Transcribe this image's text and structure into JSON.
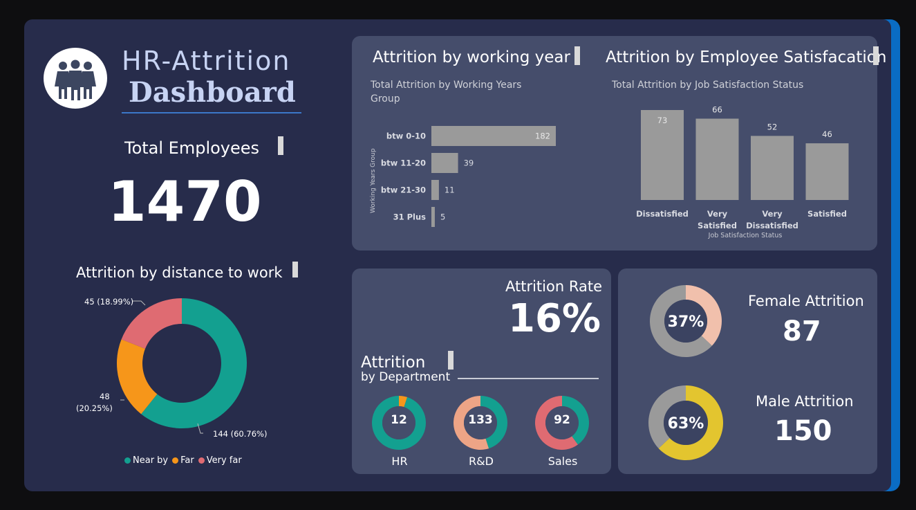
{
  "header": {
    "title_line1": "HR-Attrition",
    "title_line2": "Dashboard"
  },
  "total_employees": {
    "label": "Total Employees",
    "value": "1470"
  },
  "distance": {
    "title": "Attrition by distance to work",
    "labels": {
      "near": "144 (60.76%)",
      "far_line1": "48",
      "far_line2": "(20.25%)",
      "very_far": "45 (18.99%)"
    },
    "legend": [
      "Near by",
      "Far",
      "Very far"
    ]
  },
  "working_year": {
    "title": "Attrition by working year",
    "subtitle_line1": "Total Attrition by Working Years",
    "subtitle_line2": "Group",
    "axis_label": "Working Years Group"
  },
  "satisfaction": {
    "title": "Attrition by Employee Satisfacation",
    "subtitle": "Total Attrition by Job Satisfaction Status",
    "axis_label": "Job Satisfaction Status"
  },
  "attrition_rate": {
    "label": "Attrition Rate",
    "value": "16%"
  },
  "department": {
    "title_line1": "Attrition",
    "title_line2": "by Department",
    "items": [
      {
        "name": "HR",
        "value": "12"
      },
      {
        "name": "R&D",
        "value": "133"
      },
      {
        "name": "Sales",
        "value": "92"
      }
    ]
  },
  "gender": {
    "female": {
      "label": "Female Attrition",
      "value": "87",
      "pct": "37%"
    },
    "male": {
      "label": "Male Attrition",
      "value": "150",
      "pct": "63%"
    }
  },
  "colors": {
    "teal": "#13a090",
    "orange": "#f6961a",
    "coral": "#df6b72",
    "bar_grey": "#9a9a9a",
    "peach": "#f1c0ac",
    "yellow": "#e3c52f",
    "accent_blue": "#0a6cc4"
  },
  "chart_data": [
    {
      "type": "bar",
      "orientation": "horizontal",
      "title": "Total Attrition by Working Years Group",
      "ylabel": "Working Years Group",
      "categories": [
        "btw 0-10",
        "btw 11-20",
        "btw 21-30",
        "31 Plus"
      ],
      "values": [
        182,
        39,
        11,
        5
      ]
    },
    {
      "type": "bar",
      "title": "Total Attrition by Job Satisfaction Status",
      "xlabel": "Job Satisfaction Status",
      "categories": [
        "Dissatisfied",
        "Very Satisfied",
        "Very Dissatisfied",
        "Satisfied"
      ],
      "values": [
        73,
        66,
        52,
        46
      ]
    },
    {
      "type": "pie",
      "title": "Attrition by distance to work",
      "categories": [
        "Near by",
        "Far",
        "Very far"
      ],
      "values": [
        144,
        48,
        45
      ],
      "percent": [
        60.76,
        20.25,
        18.99
      ],
      "legend": "bottom"
    },
    {
      "type": "pie",
      "title": "Attrition by Department",
      "categories": [
        "HR",
        "R&D",
        "Sales"
      ],
      "series": [
        {
          "values": [
            12,
            0.05
          ]
        },
        {
          "values": [
            133,
            0.45
          ]
        },
        {
          "values": [
            92,
            0.4
          ]
        }
      ]
    },
    {
      "type": "pie",
      "categories": [
        "Female Attrition",
        "Male Attrition"
      ],
      "values": [
        87,
        150
      ],
      "percent": [
        37,
        63
      ]
    }
  ]
}
